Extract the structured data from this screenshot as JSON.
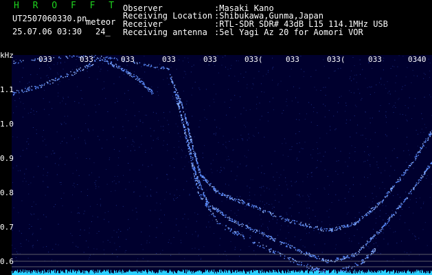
{
  "header": {
    "app_name": "H R O F F T",
    "filename": "UT2507060330.pn",
    "mode": "meteor",
    "datetime": "25.07.06 03:30",
    "counter": "24_",
    "observer_label": "Observer",
    "observer_value": ":Masaki Kano",
    "location_label": "Receiving Location",
    "location_value": ":Shibukawa,Gunma,Japan",
    "receiver_label": "Receiver",
    "receiver_value": ":RTL-SDR SDR# 43dB L15 114.1MHz USB",
    "antenna_label": "Receiving antenna",
    "antenna_value": ":5el Yagi Az 20 for Aomori VOR"
  },
  "axes": {
    "y_unit": "kHz",
    "y_ticks": [
      "1.1",
      "1.0",
      "0.9",
      "0.8",
      "0.7",
      "0.6"
    ],
    "x_ticks": [
      "033",
      "033",
      "033",
      "033",
      "033",
      "033(",
      "033",
      "033(",
      "033",
      "0340"
    ]
  },
  "colors": {
    "background": "#000000",
    "waterfall": "#00002e",
    "title": "#1fd41f",
    "signal": "#5a8cff",
    "baseline": "#2ad0ff"
  }
}
